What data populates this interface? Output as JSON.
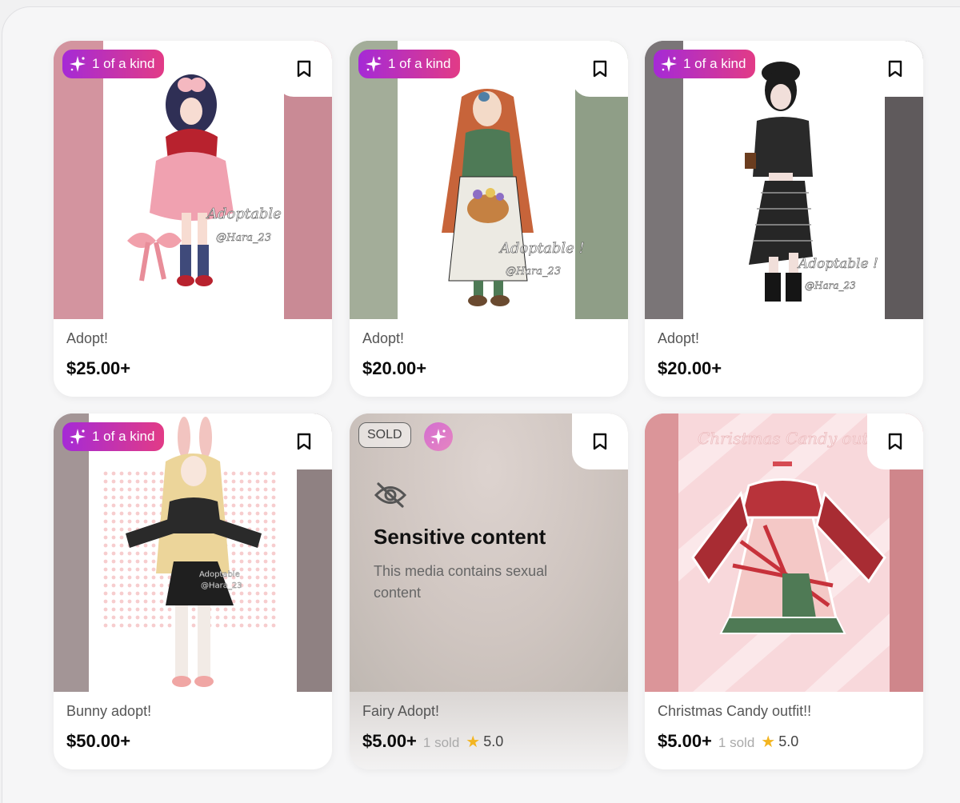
{
  "listings": [
    {
      "badge": "1 of a kind",
      "watermark": "Adoptable @Hara_23",
      "title": "Adopt!",
      "price": "$25.00+"
    },
    {
      "badge": "1 of a kind",
      "watermark": "Adoptable ! @Hara_23",
      "title": "Adopt!",
      "price": "$20.00+"
    },
    {
      "badge": "1 of a kind",
      "watermark": "Adoptable ! @Hara_23",
      "title": "Adopt!",
      "price": "$20.00+"
    },
    {
      "badge": "1 of a kind",
      "watermark": "Adoptable @Hara_23",
      "title": "Bunny adopt!",
      "price": "$50.00+"
    },
    {
      "status": "SOLD",
      "sensitive_heading": "Sensitive content",
      "sensitive_body": "This media contains sexual content",
      "title": "Fairy Adopt!",
      "price": "$5.00+",
      "sold_count": "1 sold",
      "rating": "5.0"
    },
    {
      "image_caption": "Christmas Candy outfit",
      "title": "Christmas Candy outfit!!",
      "price": "$5.00+",
      "sold_count": "1 sold",
      "rating": "5.0"
    }
  ],
  "icons": {
    "badge": "sparkle-icon",
    "save": "bookmark-icon",
    "hidden": "eye-off-icon",
    "rating": "star-icon"
  },
  "colors": {
    "badge_start": "#a52ad6",
    "badge_end": "#e23b86",
    "star": "#f3b521"
  }
}
